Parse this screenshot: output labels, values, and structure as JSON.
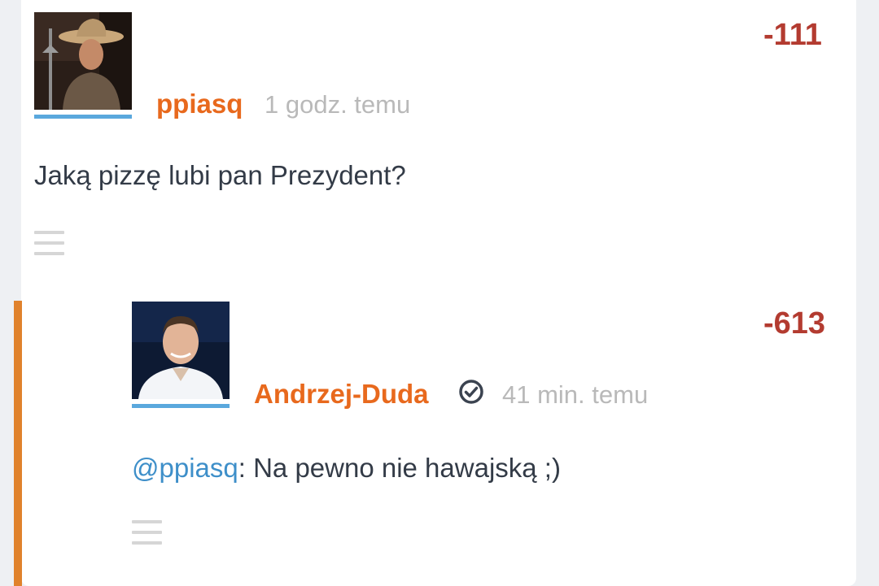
{
  "colors": {
    "page_bg": "#eef0f3",
    "card_bg": "#ffffff",
    "username": "#e8691d",
    "time": "#b9b9b9",
    "score_negative": "#b33b30",
    "body_text": "#333b47",
    "mention": "#3e8fc9",
    "avatar_underline": "#5aa8dd",
    "reply_bar": "#e0822c",
    "menu_icon": "#d6d6d6",
    "verified_icon": "#3b4350"
  },
  "comment": {
    "username": "ppiasq",
    "time": "1 godz. temu",
    "score": "-111",
    "text": "Jaką pizzę lubi pan Prezydent?",
    "avatar_icon": "user-avatar-photo",
    "menu_icon": "hamburger-menu-icon"
  },
  "reply": {
    "username": "Andrzej-Duda",
    "verified_icon": "verified-check-icon",
    "time": "41 min. temu",
    "score": "-613",
    "mention": "@ppiasq",
    "text": ": Na pewno nie hawajską ;)",
    "avatar_icon": "user-avatar-photo",
    "menu_icon": "hamburger-menu-icon"
  }
}
